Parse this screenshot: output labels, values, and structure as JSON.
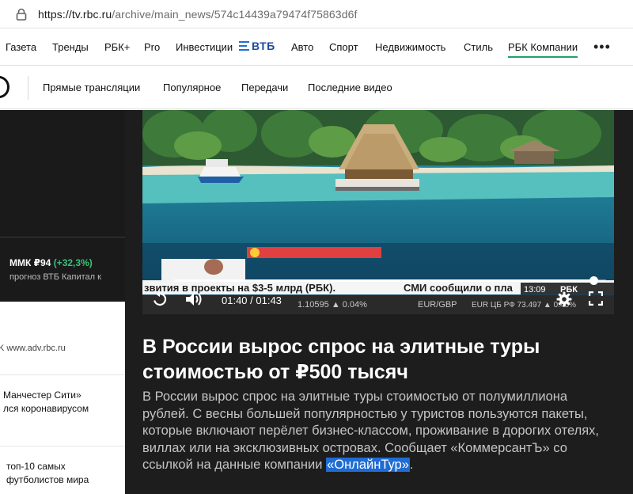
{
  "browser": {
    "url_host": "https://tv.rbc.ru",
    "url_path": "/archive/main_news/574c14439a79474f75863d6f"
  },
  "topnav": {
    "items": [
      "Газета",
      "Тренды",
      "РБК+",
      "Pro",
      "Инвестиции",
      "Авто",
      "Спорт",
      "Недвижимость",
      "Стиль",
      "РБК Компании"
    ],
    "vtb_logo_text": "ВТБ",
    "more_label": "•••"
  },
  "subnav": {
    "items": [
      "Прямые трансляции",
      "Популярное",
      "Передачи",
      "Последние видео"
    ]
  },
  "sidebar": {
    "ticker": {
      "name": "ММК ₽94",
      "change": "(+32,3%)",
      "caption": "прогноз ВТБ Капитал к"
    },
    "ad_label": "K www.adv.rbc.ru",
    "news": [
      {
        "lines": [
          "Манчестер Сити»",
          "лся коронавирусом"
        ]
      },
      {
        "lines": [
          "топ-10 самых",
          "футболистов мира"
        ]
      }
    ]
  },
  "player": {
    "time": "01:40 / 01:43",
    "progress": 0.97,
    "headline": "В России вырос спрос на элитные туры стоимостью от ₽500 тысяч",
    "lead_before": "В России вырос спрос на элитные туры стоимостью от полумиллиона рублей. С весны большей популярностью у туристов пользуются пакеты, которые включают перёлет бизнес-классом, проживание в дорогих отелях, виллах или на эксклюзивных островах. Сообщает «КоммерсантЪ» со ссылкой на данные компании ",
    "lead_highlight": "«ОнлайнТур»",
    "lead_after": ".",
    "overlay": {
      "crawl": "звития в проекты на $3-5 млрд (РБК).",
      "crawl2": "СМИ сообщили о пла",
      "clock": "13:09",
      "brand": "РБК",
      "rates": "1.10595  ▲ 0.04%",
      "pair": "EUR/GBP",
      "cb": "EUR ЦБ РФ  73.497  ▲ 0.46%"
    },
    "colors": {
      "accent": "#22a06b",
      "highlight": "#1f6cd4"
    }
  }
}
